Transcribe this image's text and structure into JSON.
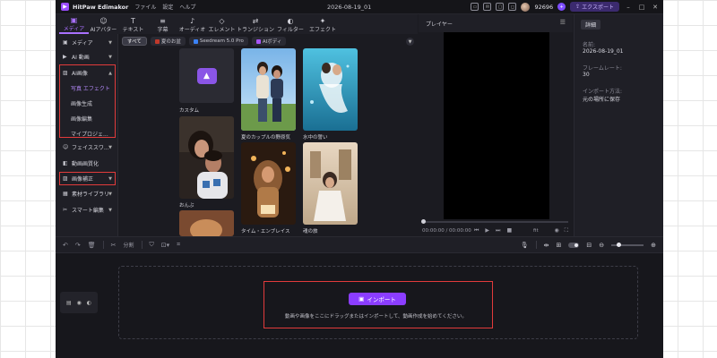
{
  "titlebar": {
    "logo_glyph": "▶",
    "app_name": "HitPaw Edimakor",
    "menu": [
      "ファイル",
      "設定",
      "ヘルプ"
    ],
    "project_name": "2026-08-19_01",
    "credits": "92696",
    "export_label": "エクスポート"
  },
  "tabs": [
    {
      "label": "メディア",
      "icon": "folder-icon"
    },
    {
      "label": "AIアバター",
      "icon": "avatar-icon"
    },
    {
      "label": "テキスト",
      "icon": "text-icon"
    },
    {
      "label": "字幕",
      "icon": "subtitle-icon"
    },
    {
      "label": "オーディオ",
      "icon": "music-icon"
    },
    {
      "label": "エレメント",
      "icon": "element-icon"
    },
    {
      "label": "トランジション",
      "icon": "transition-icon"
    },
    {
      "label": "フィルター",
      "icon": "filter-icon"
    },
    {
      "label": "エフェクト",
      "icon": "effect-icon"
    }
  ],
  "leftnav": {
    "items": [
      {
        "label": "メディア"
      },
      {
        "label": "AI 動画"
      },
      {
        "label": "AI画像"
      },
      {
        "label": "フェイススワ..."
      },
      {
        "label": "動画画質化"
      },
      {
        "label": "画像補正"
      },
      {
        "label": "素材ライブラリ"
      },
      {
        "label": "スマート編集"
      }
    ],
    "ai_image_sub": [
      "写真 エフェクト",
      "画像生成",
      "画像編集",
      "マイプロジェ..."
    ]
  },
  "media": {
    "filters": [
      "すべて",
      "夏のお盆",
      "Seedream 5.0 Pro",
      "AIボディ"
    ],
    "cards": [
      "カスタム",
      "夏のカップルの野原気",
      "水中の誓い",
      "おんぶ",
      "タイム・エンブレイス",
      "魂の旅"
    ]
  },
  "player": {
    "title": "プレイヤー",
    "timecode": "00:00:00 / 00:00:00",
    "duration": "fit"
  },
  "details": {
    "tab": "詳細",
    "name_label": "名前:",
    "name_value": "2026-08-19_01",
    "fps_label": "フレームレート:",
    "fps_value": "30",
    "import_label": "インポート方法:",
    "import_value": "元の場所に保存"
  },
  "timeline": {
    "split_label": "分割",
    "import_button": "インポート",
    "hint": "動画や画像をここにドラッグまたはインポートして、動画作成を始めてください。"
  }
}
